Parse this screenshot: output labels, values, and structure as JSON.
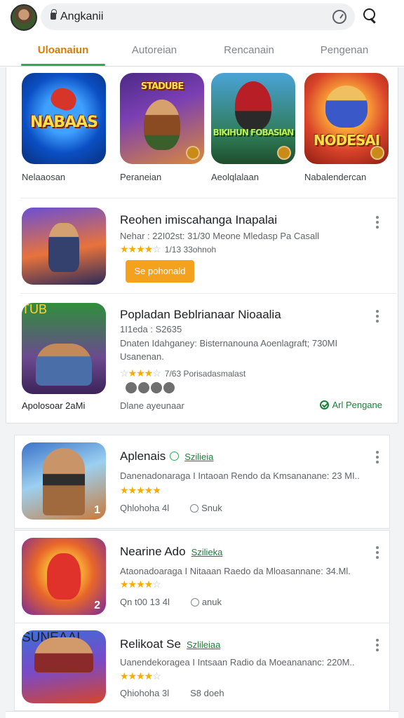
{
  "header": {
    "search_query": "Angkanii"
  },
  "tabs": [
    {
      "label": "Uloanaiun",
      "active": true
    },
    {
      "label": "Autoreian",
      "active": false
    },
    {
      "label": "Rencanain",
      "active": false
    },
    {
      "label": "Pengenan",
      "active": false
    }
  ],
  "featured_tiles": [
    {
      "art_text": "NABAAS",
      "label": "Nelaaosan"
    },
    {
      "art_text": "STADUBE",
      "label": "Peraneian"
    },
    {
      "art_text": "BIKIHUN FOBASIAN",
      "label": "Aeolqlalaan"
    },
    {
      "art_text": "NODESAI",
      "label": "Nabalendercan"
    }
  ],
  "list_items": [
    {
      "title": "Reohen imiscahanga Inapalai",
      "meta": "Nehar : 22I02st: 31/30 Meone Mledasp Pa Casall",
      "rating_suffix": "1/13 33ohnoh",
      "button_label": "Se pohonald"
    },
    {
      "title": "Popladan Beblrianaar Nioaalia",
      "meta_line1": "1I1eda : S2635",
      "meta_line2": "Dnaten Idahganey: Bisternanouna Aoenlagraft; 730MI",
      "meta_line3": "Usanenan.",
      "rating_suffix": "7/63 Porisadasmalast",
      "caption": "Apolosoar 2aMi",
      "subcaption": "Dlane ayeunaar",
      "verify_label": "Arl Pengane"
    }
  ],
  "cards": [
    {
      "title": "Aplenais",
      "badge": "Szilieia",
      "desc": "Danenadonaraga I Intaoan Rendo da Kmsananane: 23 MI..",
      "rating_suffix": "",
      "bottom_left": "Qhlohoha 4l",
      "bottom_right": "Snuk",
      "corner": "1"
    },
    {
      "title": "Nearine Ado",
      "badge": "Szilieka",
      "desc": "Ataonadoaraga I Nitaaan Raedo da Mloasannane: 34.Ml.",
      "rating_suffix": "",
      "bottom_left": "Qn t00 13 4l",
      "bottom_right": "anuk",
      "corner": "2"
    },
    {
      "title": "Relikoat Se",
      "badge": "Szlileiaa",
      "desc": "Uanendekoragea I Intsaan Radio da Moeanananc: 220M..",
      "rating_suffix": "",
      "bottom_left": "Qhiohoha 3l",
      "bottom_right": "S8 doeh",
      "corner": ""
    }
  ]
}
